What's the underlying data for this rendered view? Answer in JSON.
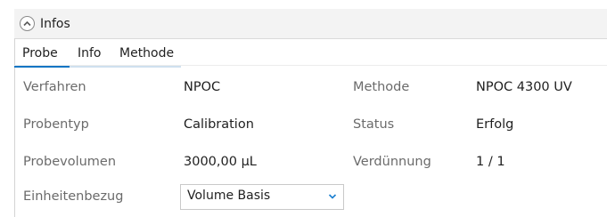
{
  "panel": {
    "title": "Infos",
    "toggle_icon": "chevron-up-circle-icon"
  },
  "tabs": [
    {
      "label": "Probe",
      "active": true
    },
    {
      "label": "Info",
      "active": false
    },
    {
      "label": "Methode",
      "active": false
    }
  ],
  "fields": {
    "verfahren": {
      "label": "Verfahren",
      "value": "NPOC"
    },
    "methode": {
      "label": "Methode",
      "value": "NPOC 4300 UV"
    },
    "probentyp": {
      "label": "Probentyp",
      "value": "Calibration"
    },
    "status": {
      "label": "Status",
      "value": "Erfolg"
    },
    "probevolumen": {
      "label": "Probevolumen",
      "value": "3000,00 µL"
    },
    "verduennung": {
      "label": "Verdünnung",
      "value": "1 / 1"
    },
    "einheitenbezug": {
      "label": "Einheitenbezug",
      "selected": "Volume Basis",
      "chevron_icon": "chevron-down-icon"
    }
  },
  "colors": {
    "accent": "#0a74c4",
    "tab_underline_inactive": "#cfe0ef",
    "label_text": "#6b6b6b",
    "value_text": "#1f1f1f",
    "header_bg": "#f3f3f3"
  }
}
